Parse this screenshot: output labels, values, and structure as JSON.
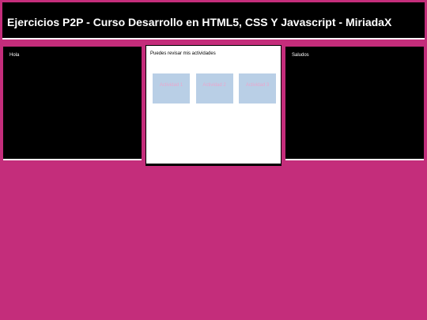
{
  "header": {
    "title": "Ejercicios P2P - Curso Desarrollo en HTML5, CSS Y Javascript - MiriadaX"
  },
  "left_panel": {
    "text": "Hola"
  },
  "center_panel": {
    "text": "Puedes revisar mis actividades",
    "activities": [
      {
        "label": "Actividad 1"
      },
      {
        "label": "Actividad 2"
      },
      {
        "label": "Actividad 3"
      }
    ]
  },
  "right_panel": {
    "text": "Saludos"
  },
  "colors": {
    "background": "#c42d7b",
    "panel_dark": "#000000",
    "tile_fill": "#b9cfe6",
    "tile_text": "#eaa7cd"
  }
}
